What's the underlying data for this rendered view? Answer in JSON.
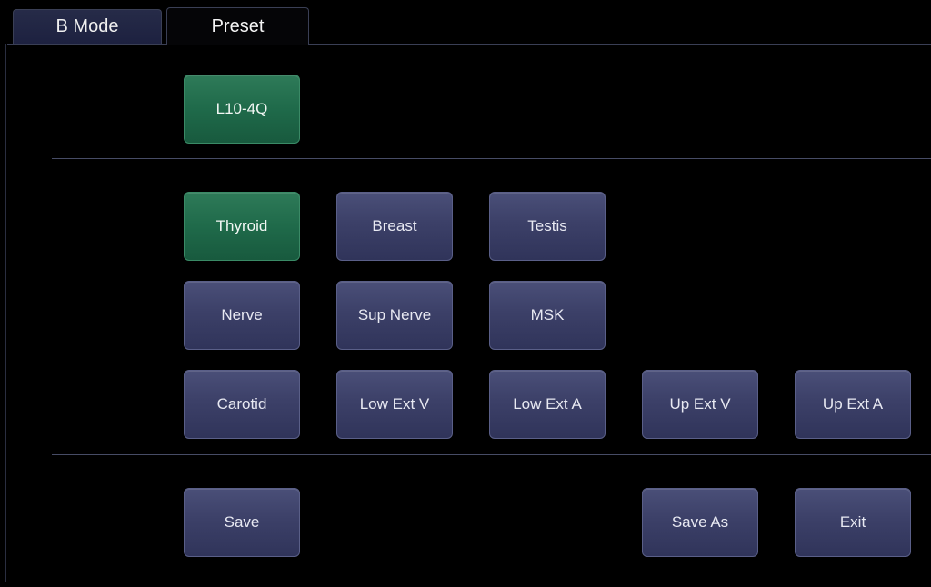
{
  "tabs": [
    {
      "label": "B Mode",
      "active": false
    },
    {
      "label": "Preset",
      "active": true
    }
  ],
  "probe": {
    "label": "L10-4Q",
    "selected": true
  },
  "presets": [
    [
      "Thyroid",
      "Breast",
      "Testis"
    ],
    [
      "Nerve",
      "Sup Nerve",
      "MSK"
    ],
    [
      "Carotid",
      "Low Ext V",
      "Low Ext A",
      "Up Ext V",
      "Up Ext A"
    ]
  ],
  "selected_preset": "Thyroid",
  "actions": {
    "save": "Save",
    "save_as": "Save As",
    "exit": "Exit"
  },
  "colors": {
    "background": "#000000",
    "button": "#3c4068",
    "selected": "#1f6a4a"
  }
}
